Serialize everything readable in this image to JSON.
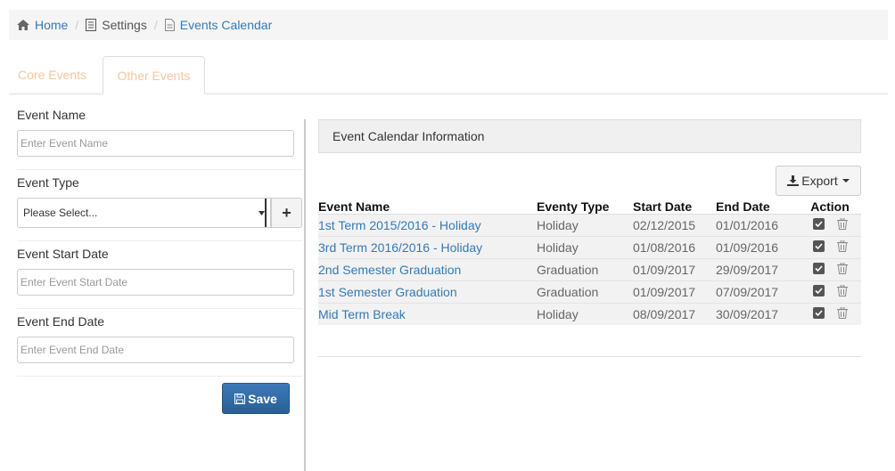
{
  "breadcrumb": {
    "home": "Home",
    "settings": "Settings",
    "current": "Events Calendar"
  },
  "tabs": {
    "core": "Core Events",
    "other": "Other Events"
  },
  "form": {
    "event_name_label": "Event Name",
    "event_name_placeholder": "Enter Event Name",
    "event_type_label": "Event Type",
    "event_type_value": "Please Select...",
    "add_button": "+",
    "start_date_label": "Event Start Date",
    "start_date_placeholder": "Enter Event Start Date",
    "end_date_label": "Event End Date",
    "end_date_placeholder": "Enter Event End Date",
    "save_label": "Save"
  },
  "panel": {
    "title": "Event Calendar Information",
    "export_label": "Export"
  },
  "table": {
    "headers": [
      "Event Name",
      "Eventy Type",
      "Start Date",
      "End Date",
      "Action"
    ],
    "rows": [
      {
        "name": "1st Term 2015/2016 - Holiday",
        "type": "Holiday",
        "start": "02/12/2015",
        "end": "01/01/2016"
      },
      {
        "name": "3rd Term 2016/2016 - Holiday",
        "type": "Holiday",
        "start": "01/08/2016",
        "end": "01/09/2016"
      },
      {
        "name": "2nd Semester Graduation",
        "type": "Graduation",
        "start": "01/09/2017",
        "end": "29/09/2017"
      },
      {
        "name": "1st Semester Graduation",
        "type": "Graduation",
        "start": "01/09/2017",
        "end": "07/09/2017"
      },
      {
        "name": "Mid Term Break",
        "type": "Holiday",
        "start": "08/09/2017",
        "end": "30/09/2017"
      }
    ]
  },
  "colors": {
    "link": "#337ab7",
    "tab_text": "#f5c6a0",
    "save_button": "#2f6ba5"
  },
  "icons": {
    "home": "home-icon",
    "settings": "document-icon",
    "calendar": "file-icon",
    "export": "download-icon",
    "save": "floppy-icon",
    "edit": "checkbox-icon",
    "delete": "trash-icon"
  }
}
